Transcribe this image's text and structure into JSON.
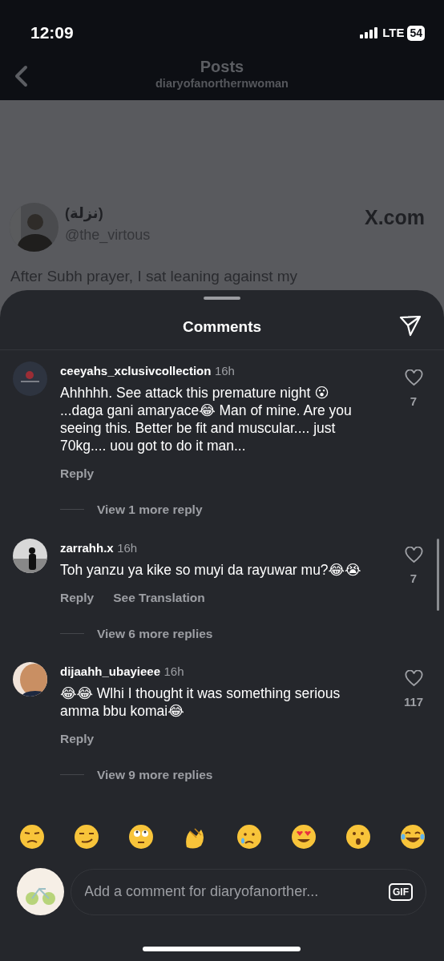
{
  "status_bar": {
    "time": "12:09",
    "network": "LTE",
    "battery": "54"
  },
  "header": {
    "title": "Posts",
    "subtitle": "diaryofanorthernwoman"
  },
  "post": {
    "display_name": "(نزلة)",
    "handle": "@the_virtous",
    "source": "X.com",
    "text": "After Subh prayer, I sat leaning against my"
  },
  "comments_sheet": {
    "title": "Comments",
    "comments": [
      {
        "username": "ceeyahs_xclusivcollection",
        "time": "16h",
        "text": "Ahhhhh. See attack this premature night 😮 ...daga gani amaryace😂 Man of mine. Are you seeing this. Better be fit and muscular.... just 70kg.... uou got to do it man...",
        "likes": "7",
        "actions": [
          "Reply"
        ],
        "view_replies": "View 1 more reply"
      },
      {
        "username": "zarrahh.x",
        "time": "16h",
        "text": "Toh yanzu ya kike so muyi da rayuwar mu?😂😭",
        "likes": "7",
        "actions": [
          "Reply",
          "See Translation"
        ],
        "view_replies": "View 6 more replies"
      },
      {
        "username": "dijaahh_ubayieee",
        "time": "16h",
        "text": "😂😂 Wlhi I thought it was something serious amma bbu komai😂",
        "likes": "117",
        "actions": [
          "Reply"
        ],
        "view_replies": "View 9 more replies"
      }
    ],
    "comment_input": {
      "placeholder": "Add a comment for diaryofanorther...",
      "gif_button": "GIF"
    }
  }
}
